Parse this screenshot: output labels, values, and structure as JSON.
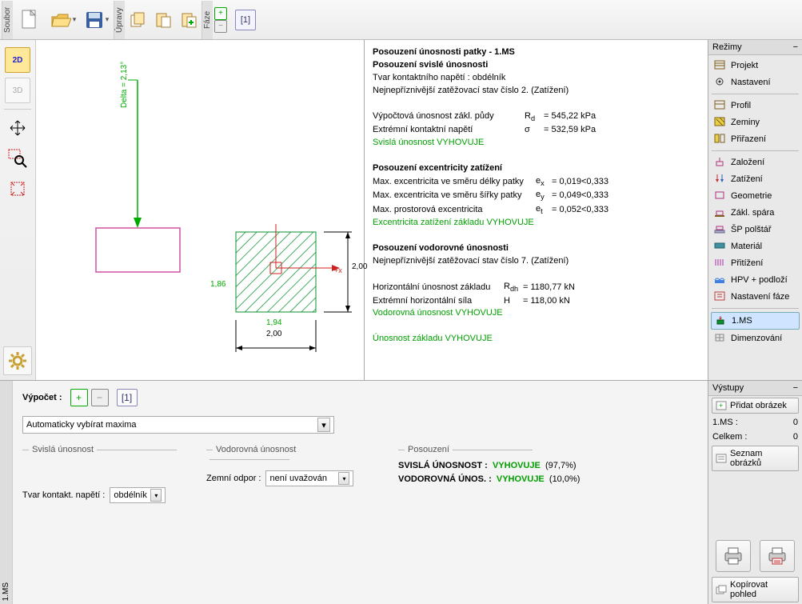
{
  "toolbar": {
    "groups": [
      "Soubor",
      "Úpravy",
      "Fáze"
    ],
    "phase_badge": "[1]"
  },
  "left_tools": {
    "btn_2d": "2D",
    "btn_3d": "3D"
  },
  "dims": {
    "delta": "Delta = 2,13°",
    "h": "1,86",
    "w1": "1,94",
    "w2": "2,00",
    "wr": "2,00",
    "axis": "+x"
  },
  "results": {
    "title1": "Posouzení únosnosti patky - 1.MS",
    "title2": "Posouzení svislé únosnosti",
    "l1": "Tvar kontaktního napětí : obdélník",
    "l2": "Nejnepříznivější zatěžovací stav číslo 2. (Zatížení)",
    "r1a": "Výpočtová únosnost zákl. půdy",
    "r1s": "R",
    "r1sub": "d",
    "r1v": "=  545,22 kPa",
    "r2a": "Extrémní kontaktní napětí",
    "r2s": "σ",
    "r2v": "=  532,59 kPa",
    "ok1": "Svislá únosnost VYHOVUJE",
    "title3": "Posouzení excentricity zatížení",
    "e1a": "Max. excentricita ve směru délky patky",
    "e1s": "e",
    "e1sub": "x",
    "e1v": "=  0,019<0,333",
    "e2a": "Max. excentricita ve směru šířky patky",
    "e2s": "e",
    "e2sub": "y",
    "e2v": "=  0,049<0,333",
    "e3a": "Max. prostorová excentricita",
    "e3s": "e",
    "e3sub": "t",
    "e3v": "=  0,052<0,333",
    "ok2": "Excentricita zatížení základu VYHOVUJE",
    "title4": "Posouzení vodorovné únosnosti",
    "l3": "Nejnepříznivější zatěžovací stav číslo 7. (Zatížení)",
    "h1a": "Horizontální únosnost základu",
    "h1s": "R",
    "h1sub": "dh",
    "h1v": "=  1180,77 kN",
    "h2a": "Extrémní horizontální síla",
    "h2s": "H",
    "h2v": "=   118,00 kN",
    "ok3": "Vodorovná únosnost VYHOVUJE",
    "ok4": "Únosnost základu VYHOVUJE"
  },
  "modes": {
    "title": "Režimy",
    "items": [
      "Projekt",
      "Nastavení",
      "Profil",
      "Zeminy",
      "Přiřazení",
      "Založení",
      "Zatížení",
      "Geometrie",
      "Zákl. spára",
      "ŠP polštář",
      "Materiál",
      "Přitížení",
      "HPV + podloží",
      "Nastavení fáze",
      "1.MS",
      "Dimenzování"
    ]
  },
  "calc": {
    "label": "Výpočet :",
    "badge": "[1]",
    "combo1": "Automaticky vybírat maxima",
    "g1": "Svislá únosnost",
    "g1_l1": "Tvar kontakt. napětí :",
    "g1_v1": "obdélník",
    "g2": "Vodorovná únosnost",
    "g2_l1": "Zemní odpor :",
    "g2_v1": "není uvažován",
    "g3": "Posouzení",
    "res1a": "SVISLÁ ÚNOSNOST :",
    "res1b": "VYHOVUJE",
    "res1c": "(97,7%)",
    "res2a": "VODOROVNÁ ÚNOS. :",
    "res2b": "VYHOVUJE",
    "res2c": "(10,0%)"
  },
  "outputs": {
    "title": "Výstupy",
    "add": "Přidat obrázek",
    "r1a": "1.MS :",
    "r1b": "0",
    "r2a": "Celkem :",
    "r2b": "0",
    "list": "Seznam obrázků",
    "copy": "Kopírovat pohled"
  },
  "bottom_tab": "1.MS",
  "colors": {
    "ok": "#00a000"
  }
}
